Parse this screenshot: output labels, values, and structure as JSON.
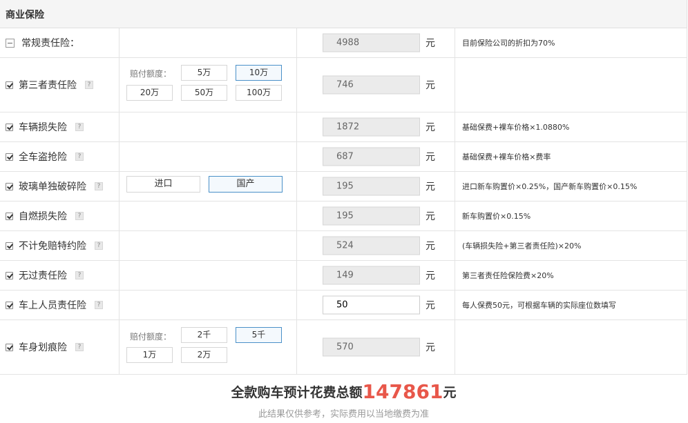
{
  "section": {
    "title": "商业保险"
  },
  "rows": [
    {
      "label": "常规责任险：",
      "amount": "4988",
      "unit": "元",
      "note": "目前保险公司的折扣为70%"
    },
    {
      "label": "第三者责任险",
      "help": "?",
      "option_label": "赔付额度：",
      "options": [
        "5万",
        "10万",
        "20万",
        "50万",
        "100万"
      ],
      "selected_option": "10万",
      "amount": "746",
      "unit": "元",
      "note": ""
    },
    {
      "label": "车辆损失险",
      "help": "?",
      "amount": "1872",
      "unit": "元",
      "note": "基础保费+裸车价格×1.0880%"
    },
    {
      "label": "全车盗抢险",
      "help": "?",
      "amount": "687",
      "unit": "元",
      "note": "基础保费+裸车价格×费率"
    },
    {
      "label": "玻璃单独破碎险",
      "help": "?",
      "options": [
        "进口",
        "国产"
      ],
      "selected_option": "国产",
      "amount": "195",
      "unit": "元",
      "note": "进口新车购置价×0.25%，国产新车购置价×0.15%"
    },
    {
      "label": "自燃损失险",
      "help": "?",
      "amount": "195",
      "unit": "元",
      "note": "新车购置价×0.15%"
    },
    {
      "label": "不计免赔特约险",
      "help": "?",
      "amount": "524",
      "unit": "元",
      "note": "(车辆损失险+第三者责任险)×20%"
    },
    {
      "label": "无过责任险",
      "help": "?",
      "amount": "149",
      "unit": "元",
      "note": "第三者责任险保险费×20%"
    },
    {
      "label": "车上人员责任险",
      "help": "?",
      "amount": "50",
      "unit": "元",
      "note": "每人保费50元，可根据车辆的实际座位数填写"
    },
    {
      "label": "车身划痕险",
      "help": "?",
      "option_label": "赔付额度：",
      "options": [
        "2千",
        "5千",
        "1万",
        "2万"
      ],
      "selected_option": "5千",
      "amount": "570",
      "unit": "元",
      "note": ""
    }
  ],
  "footer": {
    "total_prefix": "全款购车预计花费总额",
    "total_value": "147861",
    "total_suffix": "元",
    "disclaimer": "此结果仅供参考，实际费用以当地缴费为准"
  },
  "colors": {
    "accent": "#e8574a",
    "selected_border": "#4a90c8"
  }
}
